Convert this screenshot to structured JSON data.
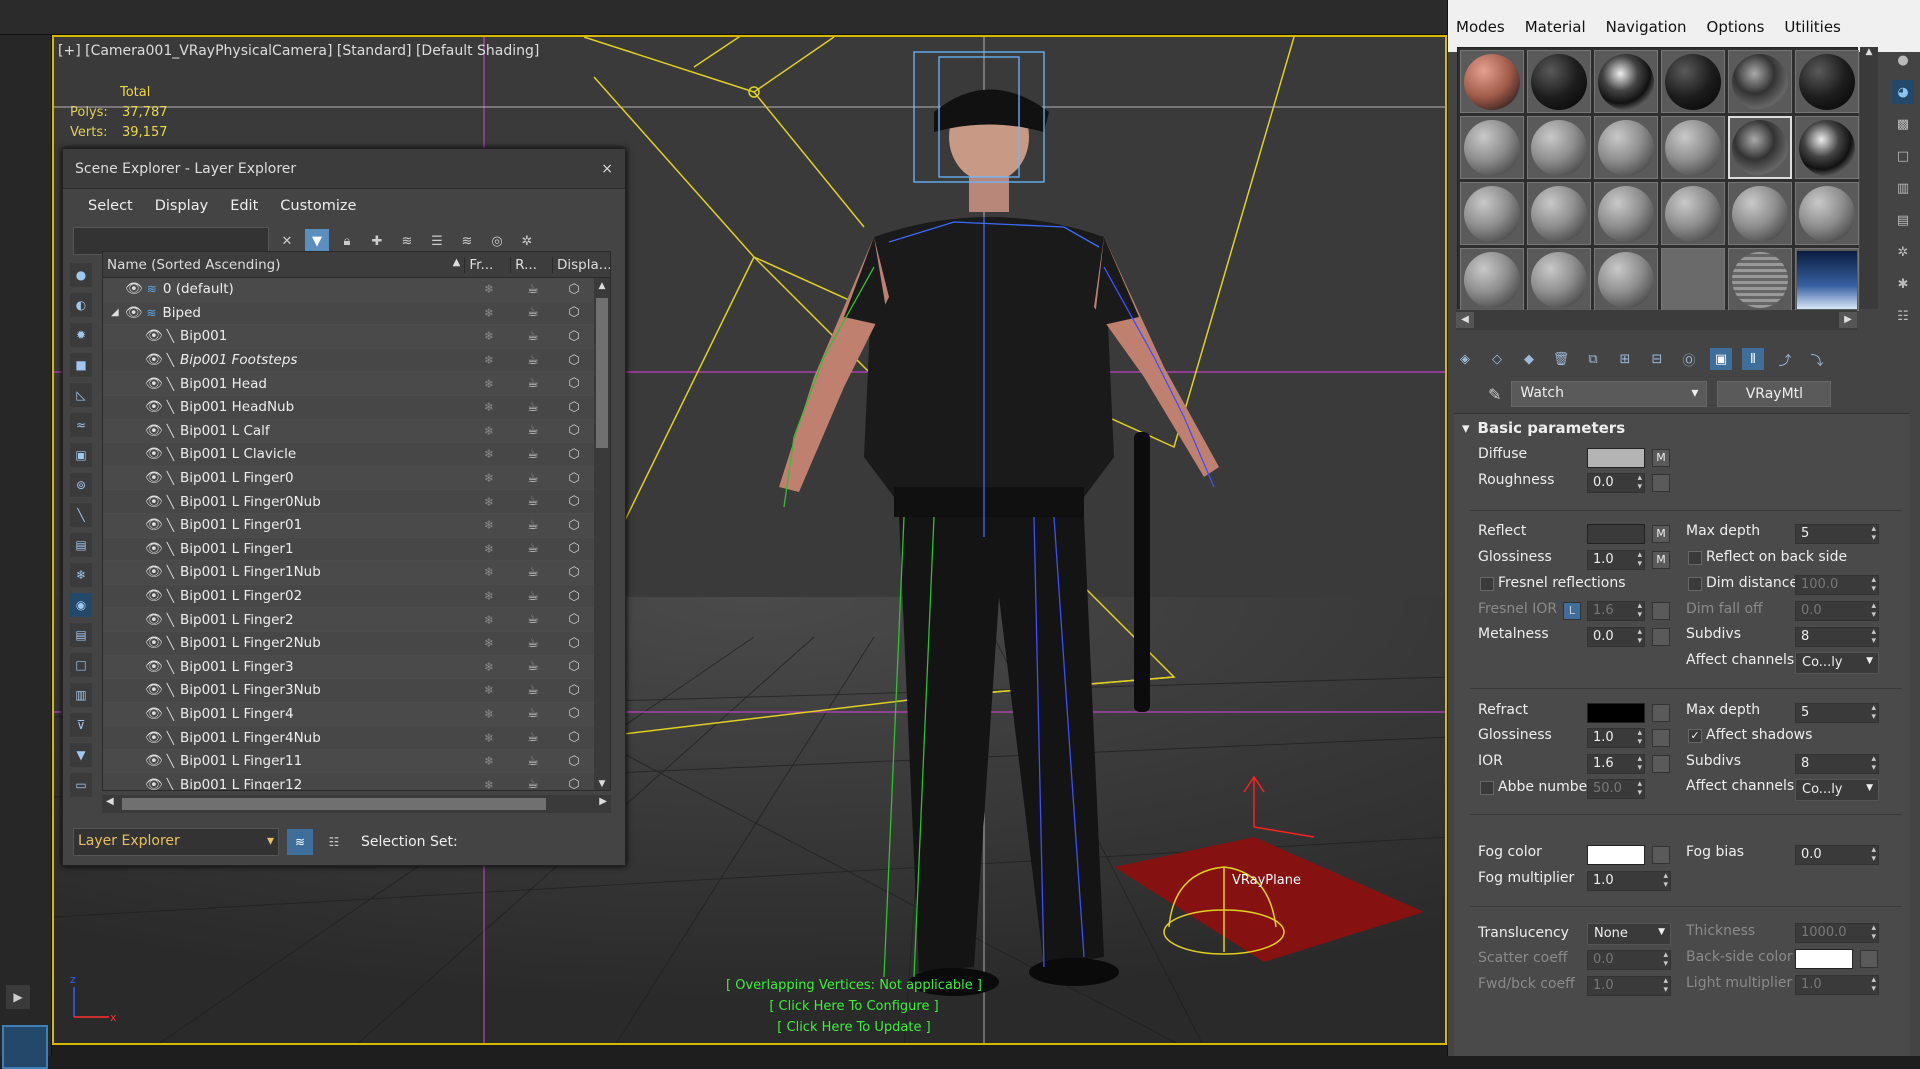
{
  "viewport": {
    "label": "[+] [Camera001_VRayPhysicalCamera] [Standard] [Default Shading]",
    "stats": {
      "total_label": "Total",
      "polys_label": "Polys:",
      "polys": "37,787",
      "verts_label": "Verts:",
      "verts": "39,157"
    },
    "messages": [
      "[ Overlapping Vertices: Not applicable ]",
      "[ Click Here To Configure ]",
      "[ Click Here To Update ]"
    ],
    "plane_label": "VRayPlane",
    "axis_x": "x",
    "axis_z": "z"
  },
  "scene_explorer": {
    "title": "Scene Explorer - Layer Explorer",
    "close": "×",
    "menu": [
      "Select",
      "Display",
      "Edit",
      "Customize"
    ],
    "columns": {
      "name": "Name (Sorted Ascending)",
      "freeze": "Fr...",
      "render": "R...",
      "display": "Displa..."
    },
    "rows": [
      {
        "name": "0 (default)",
        "indent": 1,
        "kind": "layer"
      },
      {
        "name": "Biped",
        "indent": 0,
        "kind": "layer-open"
      },
      {
        "name": "Bip001",
        "indent": 2,
        "kind": "bone"
      },
      {
        "name": "Bip001 Footsteps",
        "indent": 2,
        "kind": "bone",
        "italic": true
      },
      {
        "name": "Bip001 Head",
        "indent": 2,
        "kind": "bone"
      },
      {
        "name": "Bip001 HeadNub",
        "indent": 2,
        "kind": "bone"
      },
      {
        "name": "Bip001 L Calf",
        "indent": 2,
        "kind": "bone"
      },
      {
        "name": "Bip001 L Clavicle",
        "indent": 2,
        "kind": "bone"
      },
      {
        "name": "Bip001 L Finger0",
        "indent": 2,
        "kind": "bone"
      },
      {
        "name": "Bip001 L Finger0Nub",
        "indent": 2,
        "kind": "bone"
      },
      {
        "name": "Bip001 L Finger01",
        "indent": 2,
        "kind": "bone"
      },
      {
        "name": "Bip001 L Finger1",
        "indent": 2,
        "kind": "bone"
      },
      {
        "name": "Bip001 L Finger1Nub",
        "indent": 2,
        "kind": "bone"
      },
      {
        "name": "Bip001 L Finger02",
        "indent": 2,
        "kind": "bone"
      },
      {
        "name": "Bip001 L Finger2",
        "indent": 2,
        "kind": "bone"
      },
      {
        "name": "Bip001 L Finger2Nub",
        "indent": 2,
        "kind": "bone"
      },
      {
        "name": "Bip001 L Finger3",
        "indent": 2,
        "kind": "bone"
      },
      {
        "name": "Bip001 L Finger3Nub",
        "indent": 2,
        "kind": "bone"
      },
      {
        "name": "Bip001 L Finger4",
        "indent": 2,
        "kind": "bone"
      },
      {
        "name": "Bip001 L Finger4Nub",
        "indent": 2,
        "kind": "bone"
      },
      {
        "name": "Bip001 L Finger11",
        "indent": 2,
        "kind": "bone"
      },
      {
        "name": "Bip001 L Finger12",
        "indent": 2,
        "kind": "bone"
      }
    ],
    "footer": {
      "explorer": "Layer Explorer",
      "selection_set": "Selection Set:"
    }
  },
  "material_editor": {
    "menu": [
      "Modes",
      "Material",
      "Navigation",
      "Options",
      "Utilities"
    ],
    "slots": [
      "skin",
      "dark",
      "chrome",
      "dark",
      "metal",
      "dark",
      "gray",
      "gray",
      "gray",
      "gray",
      "metal",
      "chrome",
      "gray",
      "gray",
      "gray",
      "gray",
      "gray",
      "gray",
      "gray",
      "gray",
      "gray",
      "empty",
      "grid",
      "snow"
    ],
    "material_name": "Watch",
    "material_type": "VRayMtl",
    "rollout": {
      "title": "Basic parameters",
      "diffuse": "Diffuse",
      "diffuse_m": "M",
      "roughness": "Roughness",
      "roughness_val": "0.0",
      "reflect": "Reflect",
      "reflect_m": "M",
      "glossiness": "Glossiness",
      "glossiness_val": "1.0",
      "gloss_m": "M",
      "fresnel": "Fresnel reflections",
      "fresnel_ior": "Fresnel IOR",
      "fresnel_ior_l": "L",
      "fresnel_ior_val": "1.6",
      "metalness": "Metalness",
      "metalness_val": "0.0",
      "max_depth": "Max depth",
      "max_depth_val": "5",
      "reflect_back": "Reflect on back side",
      "dim_distance": "Dim distance",
      "dim_distance_val": "100.0",
      "dim_falloff": "Dim fall off",
      "dim_falloff_val": "0.0",
      "subdivs": "Subdivs",
      "subdivs_val": "8",
      "affect_channels": "Affect channels",
      "affect_channels_val": "Co...ly",
      "refract": "Refract",
      "r_glossiness": "Glossiness",
      "r_glossiness_val": "1.0",
      "ior": "IOR",
      "ior_val": "1.6",
      "abbe": "Abbe number",
      "abbe_val": "50.0",
      "r_max_depth": "Max depth",
      "r_max_depth_val": "5",
      "affect_shadows": "Affect shadows",
      "r_subdivs": "Subdivs",
      "r_subdivs_val": "8",
      "r_affect_channels": "Affect channels",
      "r_affect_channels_val": "Co...ly",
      "fog_color": "Fog color",
      "fog_bias": "Fog bias",
      "fog_bias_val": "0.0",
      "fog_mult": "Fog multiplier",
      "fog_mult_val": "1.0",
      "translucency": "Translucency",
      "translucency_val": "None",
      "thickness": "Thickness",
      "thickness_val": "1000.0",
      "scatter": "Scatter coeff",
      "scatter_val": "0.0",
      "backside": "Back-side color",
      "fwdbck": "Fwd/bck coeff",
      "fwdbck_val": "1.0",
      "light_mult": "Light multiplier",
      "light_mult_val": "1.0"
    }
  },
  "colors": {
    "viewport_border": "#d6b800",
    "accent": "#3d6e9c",
    "stats": "#e8d84c",
    "messages": "#3cf03c"
  }
}
